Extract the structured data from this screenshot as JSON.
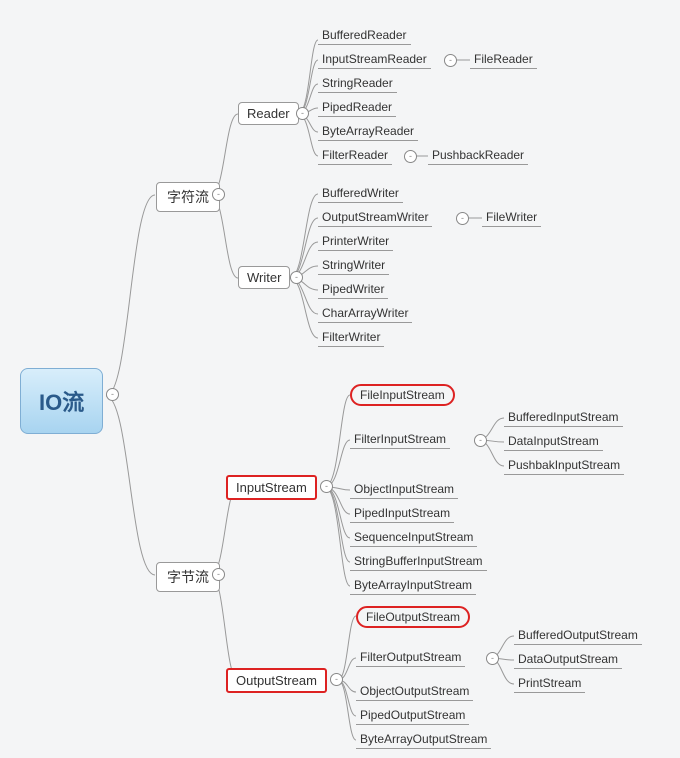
{
  "root": "IO流",
  "branches": {
    "char": "字符流",
    "byte": "字节流"
  },
  "sub": {
    "reader": "Reader",
    "writer": "Writer",
    "input": "InputStream",
    "output": "OutputStream"
  },
  "reader": {
    "l0": "BufferedReader",
    "l1": "InputStreamReader",
    "l1a": "FileReader",
    "l2": "StringReader",
    "l3": "PipedReader",
    "l4": "ByteArrayReader",
    "l5": "FilterReader",
    "l5a": "PushbackReader"
  },
  "writer": {
    "l0": "BufferedWriter",
    "l1": "OutputStreamWriter",
    "l1a": "FileWriter",
    "l2": "PrinterWriter",
    "l3": "StringWriter",
    "l4": "PipedWriter",
    "l5": "CharArrayWriter",
    "l6": "FilterWriter"
  },
  "input": {
    "l0": "FileInputStream",
    "l1": "FilterInputStream",
    "l1a": "BufferedInputStream",
    "l1b": "DataInputStream",
    "l1c": "PushbakInputStream",
    "l2": "ObjectInputStream",
    "l3": "PipedInputStream",
    "l4": "SequenceInputStream",
    "l5": "StringBufferInputStream",
    "l6": "ByteArrayInputStream"
  },
  "output": {
    "l0": "FileOutputStream",
    "l1": "FilterOutputStream",
    "l1a": "BufferedOutputStream",
    "l1b": "DataOutputStream",
    "l1c": "PrintStream",
    "l2": "ObjectOutputStream",
    "l3": "PipedOutputStream",
    "l4": "ByteArrayOutputStream"
  },
  "toggle_glyph": "-"
}
